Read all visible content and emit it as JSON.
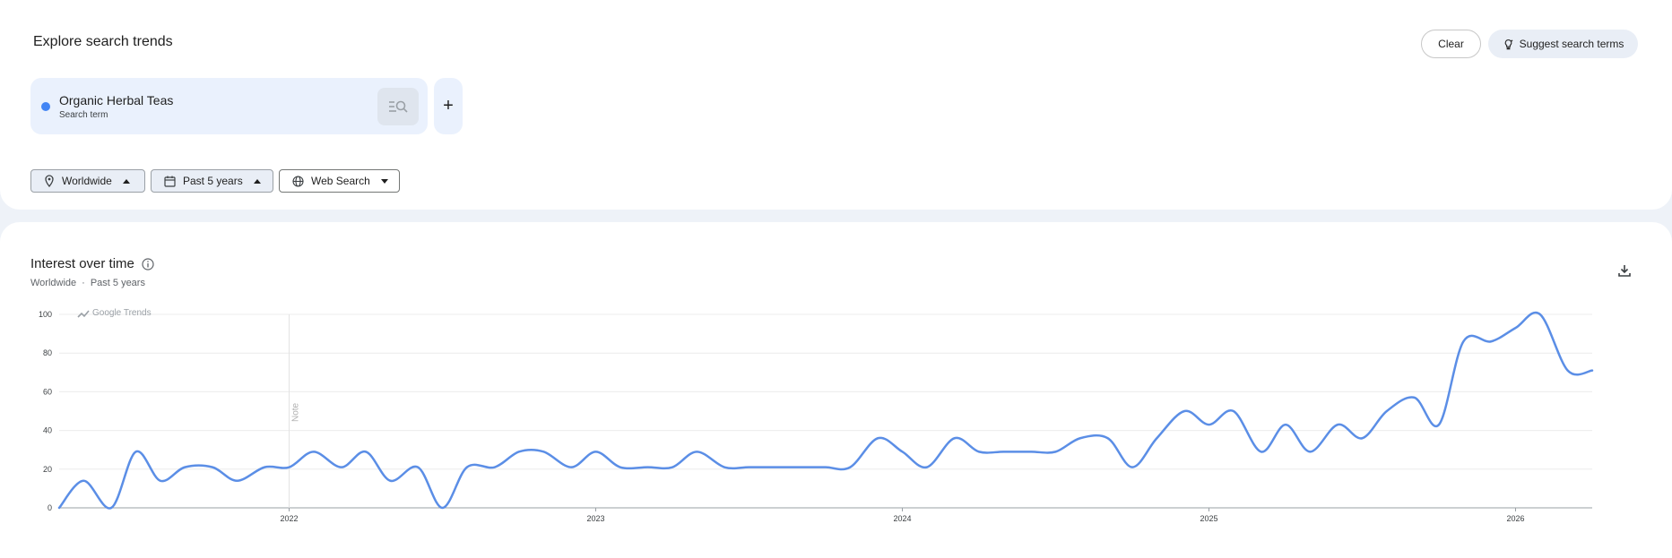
{
  "explore": {
    "title": "Explore search trends",
    "clear_label": "Clear",
    "suggest_label": "Suggest search terms"
  },
  "term": {
    "name": "Organic Herbal Teas",
    "type": "Search term",
    "color": "#4285f4"
  },
  "add_label": "+",
  "filters": {
    "location": "Worldwide",
    "time": "Past 5 years",
    "property": "Web Search"
  },
  "chart_section": {
    "title": "Interest over time",
    "subtitle_location": "Worldwide",
    "subtitle_sep": "·",
    "subtitle_time": "Past 5 years",
    "watermark": "Google Trends",
    "note_label": "Note"
  },
  "chart_data": {
    "type": "line",
    "ylim": [
      0,
      100
    ],
    "yticks": [
      0,
      20,
      40,
      60,
      80,
      100
    ],
    "xticks": [
      "2022",
      "2023",
      "2024",
      "2025",
      "2026"
    ],
    "grid": true,
    "series": [
      {
        "color": "#5b8ee6",
        "x": [
          2021.25,
          2021.33,
          2021.42,
          2021.5,
          2021.58,
          2021.66,
          2021.75,
          2021.83,
          2021.92,
          2022.0,
          2022.08,
          2022.17,
          2022.25,
          2022.33,
          2022.42,
          2022.5,
          2022.58,
          2022.67,
          2022.75,
          2022.83,
          2022.92,
          2023.0,
          2023.08,
          2023.17,
          2023.25,
          2023.33,
          2023.42,
          2023.5,
          2023.58,
          2023.67,
          2023.75,
          2023.83,
          2023.92,
          2024.0,
          2024.08,
          2024.17,
          2024.25,
          2024.33,
          2024.42,
          2024.5,
          2024.58,
          2024.67,
          2024.75,
          2024.83,
          2024.92,
          2025.0,
          2025.08,
          2025.17,
          2025.25,
          2025.33,
          2025.42,
          2025.5,
          2025.58,
          2025.67,
          2025.75,
          2025.83,
          2025.92,
          2026.0,
          2026.08,
          2026.17,
          2026.25
        ],
        "values": [
          0,
          14,
          0,
          29,
          14,
          21,
          21,
          14,
          21,
          21,
          29,
          21,
          29,
          14,
          21,
          0,
          21,
          21,
          29,
          29,
          21,
          29,
          21,
          21,
          21,
          29,
          21,
          21,
          21,
          21,
          21,
          21,
          36,
          29,
          21,
          36,
          29,
          29,
          29,
          29,
          36,
          36,
          21,
          36,
          50,
          43,
          50,
          29,
          43,
          29,
          43,
          36,
          50,
          57,
          43,
          86,
          86,
          93,
          100,
          71,
          71
        ]
      }
    ]
  }
}
